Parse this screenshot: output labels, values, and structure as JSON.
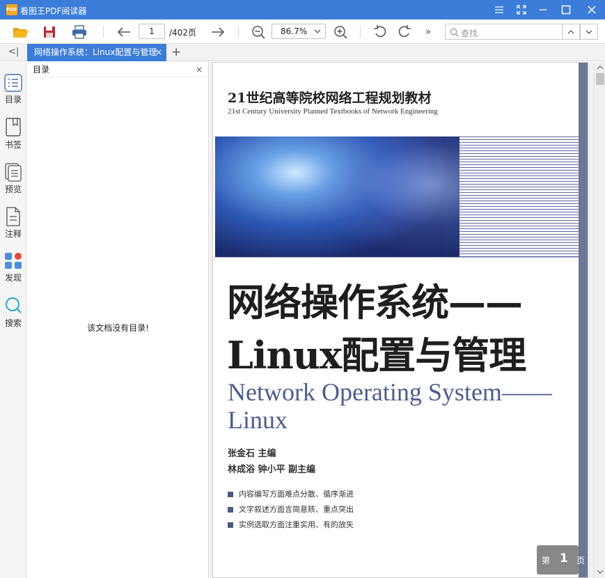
{
  "app": {
    "logo": "PDF",
    "title": "看图王PDF阅读器"
  },
  "window": {
    "menu_icon": "menu-icon",
    "fullscreen_icon": "fullscreen-icon",
    "min_icon": "minimize-icon",
    "max_icon": "maximize-icon",
    "close_icon": "close-icon"
  },
  "toolbar": {
    "open_icon": "folder-open-icon",
    "save_icon": "save-icon",
    "print_icon": "print-icon",
    "current_page": "1",
    "total_pages": "/402页",
    "zoom": "86.7%",
    "more": "»",
    "search_placeholder": "查找"
  },
  "tabs": [
    {
      "label": "网络操作系统：Linux配置与管理",
      "close": "×"
    }
  ],
  "tab_add": "+",
  "sidebar_toggle": "<|",
  "leftnav": [
    {
      "label": "目录",
      "icon": "toc-icon"
    },
    {
      "label": "书签",
      "icon": "bookmark-icon"
    },
    {
      "label": "预览",
      "icon": "preview-icon"
    },
    {
      "label": "注释",
      "icon": "annotation-icon"
    },
    {
      "label": "发现",
      "icon": "discover-icon"
    },
    {
      "label": "搜索",
      "icon": "search-icon"
    }
  ],
  "panel": {
    "title": "目录",
    "close": "×",
    "empty_message": "该文档没有目录!"
  },
  "cover": {
    "series_cn": "21世纪高等院校网络工程规划教材",
    "series_en": "21st Century University Planned Textbooks of Network Engineering",
    "title_cn_line1": "网络操作系统——",
    "title_cn_line2": "Linux配置与管理",
    "title_en_line1": "Network Operating System——",
    "title_en_line2": "Linux",
    "author_main": "张金石  主编",
    "author_assoc": "林成浴  钟小平  副主编",
    "bullets": [
      "内容编写方面难点分散、循序渐进",
      "文字叙述方面言简意赅、重点突出",
      "实例选取方面注重实用、有的放矢"
    ]
  },
  "page_indicator": {
    "prefix": "第",
    "number": "1",
    "suffix": "页"
  },
  "colors": {
    "accent": "#3c7dd9",
    "title_blue": "#4d5c8c"
  }
}
